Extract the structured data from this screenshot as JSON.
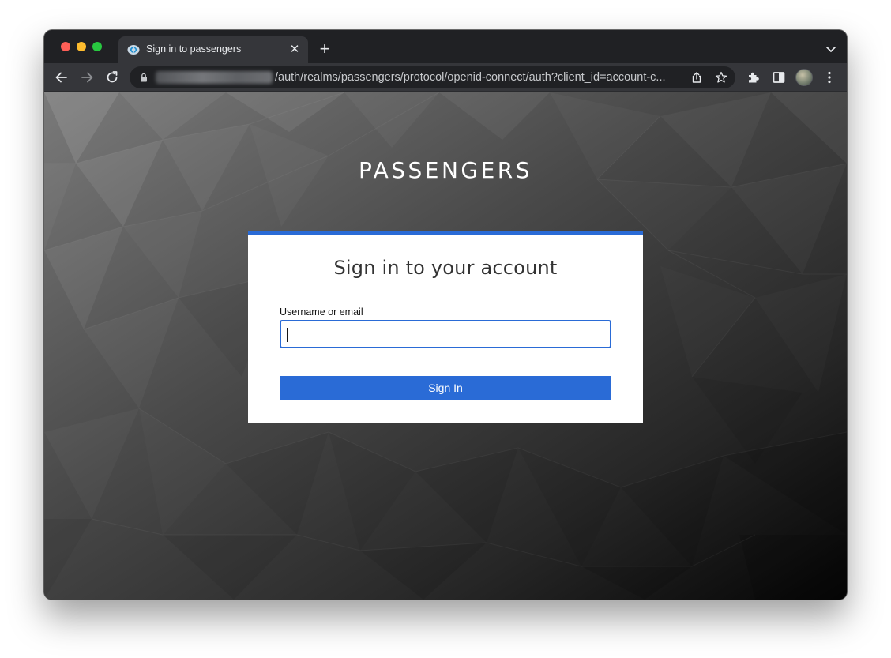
{
  "browser": {
    "tab": {
      "title": "Sign in to passengers",
      "close_glyph": "✕",
      "favicon": "keycloak-favicon-icon"
    },
    "new_tab_glyph": "+",
    "omnibox": {
      "url_path": "/auth/realms/passengers/protocol/openid-connect/auth?client_id=account-c..."
    },
    "colors": {
      "frame": "#202124",
      "toolbar": "#35363a",
      "tab_text": "#e8eaed"
    }
  },
  "page": {
    "realm_title": "PASSENGERS",
    "card": {
      "heading": "Sign in to your account",
      "username_label": "Username or email",
      "username_value": "",
      "submit_label": "Sign In"
    },
    "colors": {
      "accent": "#2a6bd6",
      "card_bg": "#ffffff",
      "heading_text": "#333333"
    }
  }
}
